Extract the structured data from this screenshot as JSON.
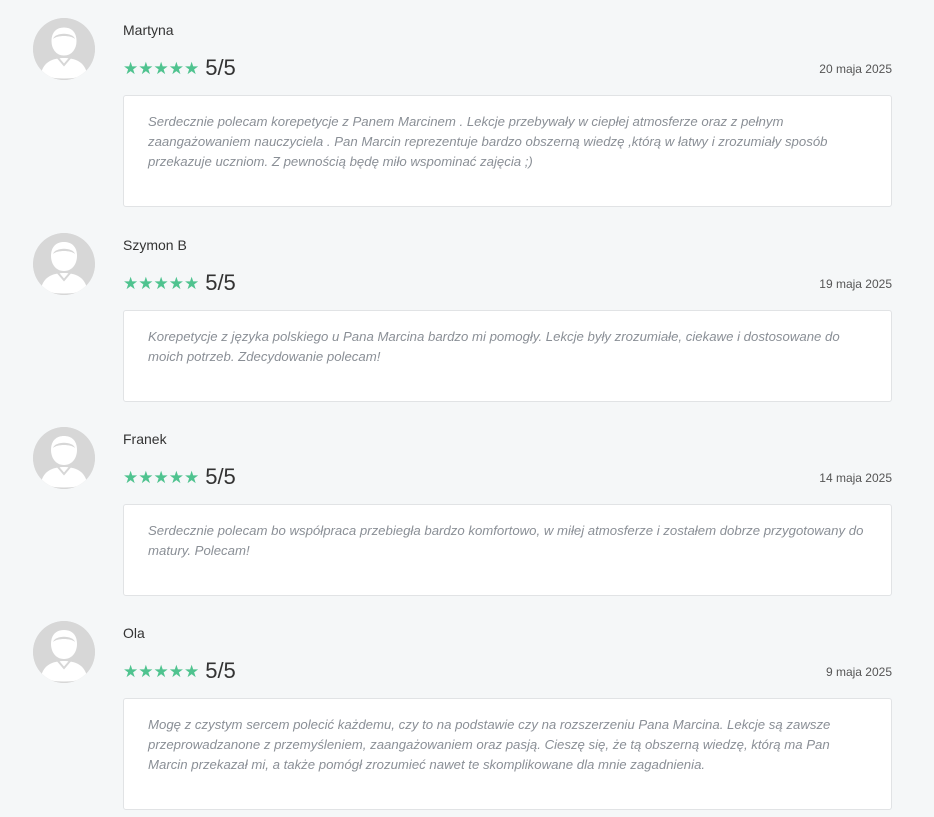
{
  "reviews": [
    {
      "name": "Martyna",
      "score": "5/5",
      "stars": "★★★★★",
      "date": "20 maja 2025",
      "text": "Serdecznie polecam korepetycje z Panem Marcinem . Lekcje przebywały w ciepłej atmosferze oraz z pełnym zaangażowaniem nauczyciela . Pan Marcin reprezentuje bardzo obszerną wiedzę ,którą w łatwy i zrozumiały sposób przekazuje uczniom. Z pewnością będę miło wspominać zajęcia ;)"
    },
    {
      "name": "Szymon B",
      "score": "5/5",
      "stars": "★★★★★",
      "date": "19 maja 2025",
      "text": "Korepetycje z języka polskiego u Pana Marcina bardzo mi pomogły. Lekcje były zrozumiałe, ciekawe i dostosowane do moich potrzeb. Zdecydowanie polecam!"
    },
    {
      "name": "Franek",
      "score": "5/5",
      "stars": "★★★★★",
      "date": "14 maja 2025",
      "text": "Serdecznie polecam bo współpraca przebiegła bardzo komfortowo, w miłej atmosferze i zostałem dobrze przygotowany do matury. Polecam!"
    },
    {
      "name": "Ola",
      "score": "5/5",
      "stars": "★★★★★",
      "date": "9 maja 2025",
      "text": "Mogę z czystym sercem polecić każdemu, czy to na podstawie czy na rozszerzeniu Pana Marcina. Lekcje są zawsze przeprowadzanone z przemyśleniem, zaangażowaniem oraz pasją. Cieszę się, że tą obszerną wiedzę, którą ma Pan Marcin przekazał mi, a także pomógł zrozumieć nawet te skomplikowane dla mnie zagadnienia."
    }
  ],
  "colors": {
    "star": "#4fc38f",
    "avatar_bg": "#d7d7d7",
    "page_bg": "#f5f7f8"
  }
}
